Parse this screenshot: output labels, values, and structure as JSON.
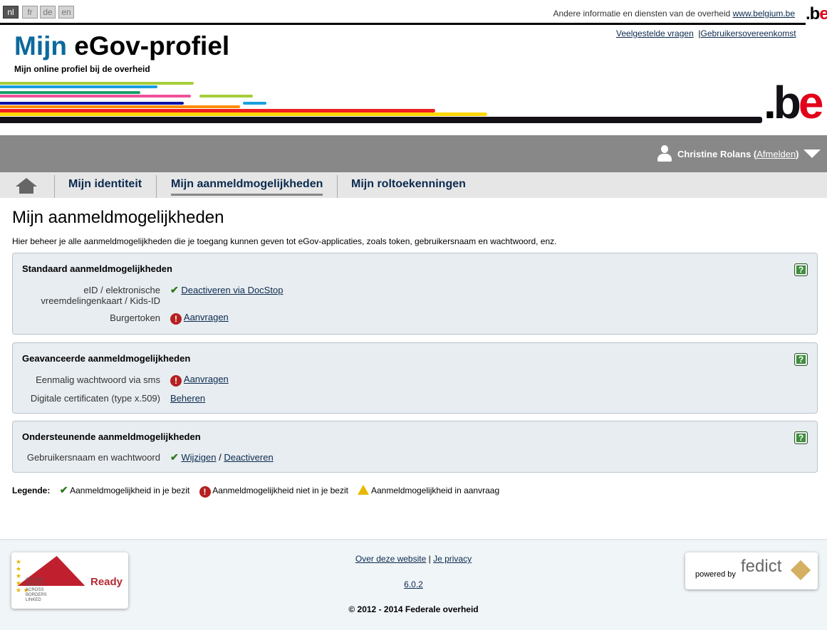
{
  "languages": [
    "nl",
    "fr",
    "de",
    "en"
  ],
  "top": {
    "other_info": "Andere informatie en diensten van de overheid ",
    "belgium_link": "www.belgium.be",
    "faq": "Veelgestelde vragen",
    "terms": "Gebruikersovereenkomst"
  },
  "header": {
    "title_part1": "Mijn",
    "title_part2": " eGov-profiel",
    "subtitle": "Mijn online profiel bij de overheid",
    "logo": ".be"
  },
  "user": {
    "name": "Christine Rolans",
    "logout": "Afmelden"
  },
  "tabs": [
    "Mijn identiteit",
    "Mijn aanmeldmogelijkheden",
    "Mijn roltoekenningen"
  ],
  "page": {
    "title": "Mijn aanmeldmogelijkheden",
    "intro": "Hier beheer je alle aanmeldmogelijkheden die je toegang kunnen geven tot eGov-applicaties, zoals token, gebruikersnaam en wachtwoord, enz."
  },
  "panels": [
    {
      "title": "Standaard aanmeldmogelijkheden",
      "rows": [
        {
          "label": "eID / elektronische vreemdelingenkaart / Kids-ID",
          "status": "ok",
          "links": [
            "Deactiveren via DocStop"
          ]
        },
        {
          "label": "Burgertoken",
          "status": "missing",
          "links": [
            "Aanvragen"
          ]
        }
      ]
    },
    {
      "title": "Geavanceerde aanmeldmogelijkheden",
      "rows": [
        {
          "label": "Eenmalig wachtwoord via sms",
          "status": "missing",
          "links": [
            "Aanvragen"
          ]
        },
        {
          "label": "Digitale certificaten (type x.509)",
          "status": "none",
          "links": [
            "Beheren"
          ]
        }
      ]
    },
    {
      "title": "Ondersteunende aanmeldmogelijkheden",
      "rows": [
        {
          "label": "Gebruikersnaam en wachtwoord",
          "status": "ok",
          "links": [
            "Wijzigen",
            "Deactiveren"
          ]
        }
      ]
    }
  ],
  "legend": {
    "label": "Legende:",
    "ok": "Aanmeldmogelijkheid in je bezit",
    "missing": "Aanmeldmogelijkheid niet in je bezit",
    "pending": "Aanmeldmogelijkheid in aanvraag"
  },
  "footer": {
    "about": "Over deze website",
    "privacy": "Je privacy",
    "version": "6.0.2",
    "copyright": "© 2012 - 2014 Federale overheid",
    "stork_ready": "Ready",
    "stork_text": "SECURE IDENTITY ACROSS BORDERS LINKED",
    "powered": "powered by",
    "fedict": "fedict"
  },
  "colors": {
    "title_blue": "#0b6a9c",
    "nav_gray": "#888888",
    "tab_bar": "#e6e6e6",
    "panel_bg": "#e8edf1",
    "footer_bg": "#f0f5f8"
  }
}
